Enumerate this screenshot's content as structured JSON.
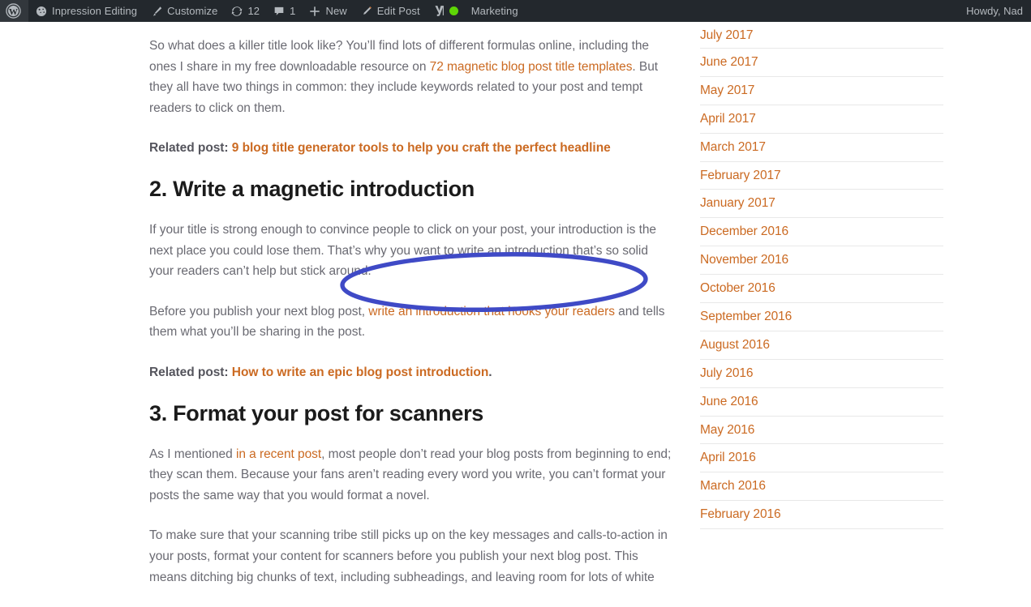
{
  "adminbar": {
    "wp_logo_icon": "wordpress-logo-icon",
    "items": [
      {
        "label": "Inpression Editing",
        "icon": "dashboard-gauge-icon"
      },
      {
        "label": "Customize",
        "icon": "paintbrush-icon"
      },
      {
        "label": "12",
        "icon": "updates-arrows-icon"
      },
      {
        "label": "1",
        "icon": "comment-bubble-icon"
      },
      {
        "label": "New",
        "icon": "plus-icon"
      },
      {
        "label": "Edit Post",
        "icon": "pencil-icon"
      },
      {
        "label": "",
        "icon": "yoast-seo-icon",
        "status_icon": "green-dot-icon"
      },
      {
        "label": "Marketing",
        "icon": ""
      }
    ],
    "howdy": "Howdy, Nad",
    "bg_color": "#23282d",
    "text_color": "#b4b9be",
    "status_color": "#5ed606"
  },
  "article": {
    "p1": {
      "before": "So what does a killer title look like? You’ll find lots of different formulas online, including the ones I share in my free downloadable resource on ",
      "link": "72 magnetic blog post title templates",
      "after": ". But they all have two things in common: they include keywords related to your post and tempt readers to click on them."
    },
    "related1": {
      "label": "Related post: ",
      "link": "9 blog title generator tools to help you craft the perfect headline"
    },
    "h2_a": "2. Write a magnetic introduction",
    "p2": "If your title is strong enough to convince people to click on your post, your introduction is the next place you could lose them. That’s why you want to write an introduction that’s so solid your readers can’t help but stick around.",
    "p3": {
      "before": "Before you publish your next blog post, ",
      "link": "write an introduction that hooks your readers",
      "after": " and tells them what you’ll be sharing in the post."
    },
    "related2": {
      "label": "Related post: ",
      "link": "How to write an epic blog post introduction",
      "tail": "."
    },
    "h2_b": "3. Format your post for scanners",
    "p4": {
      "before": "As I mentioned ",
      "link": "in a recent post",
      "after": ", most people don’t read your blog posts from beginning to end; they scan them. Because your fans aren’t reading every word you write, you can’t format your posts the same way that you would format a novel."
    },
    "p5": "To make sure that your scanning tribe still picks up on the key messages and calls-to-action in your posts, format your content for scanners before you publish your next blog post. This means ditching big chunks of text, including subheadings, and leaving room for lots of white",
    "link_color": "#cb6a22",
    "body_text_color": "#6a6a72",
    "heading_color": "#1b1b1b"
  },
  "sidebar": {
    "name": "archives-widget",
    "items": [
      {
        "label": "July 2017"
      },
      {
        "label": "June 2017"
      },
      {
        "label": "May 2017"
      },
      {
        "label": "April 2017"
      },
      {
        "label": "March 2017"
      },
      {
        "label": "February 2017"
      },
      {
        "label": "January 2017"
      },
      {
        "label": "December 2016"
      },
      {
        "label": "November 2016"
      },
      {
        "label": "October 2016"
      },
      {
        "label": "September 2016"
      },
      {
        "label": "August 2016"
      },
      {
        "label": "July 2016"
      },
      {
        "label": "June 2016"
      },
      {
        "label": "May 2016"
      },
      {
        "label": "April 2016"
      },
      {
        "label": "March 2016"
      },
      {
        "label": "February 2016"
      }
    ],
    "link_color": "#cb6a22",
    "divider_color": "#e8e8e8"
  },
  "annotation": {
    "type": "ellipse-highlight",
    "color": "#3f4ac6",
    "stroke_width": 5,
    "target_text": "write an introduction that hooks your readers"
  }
}
